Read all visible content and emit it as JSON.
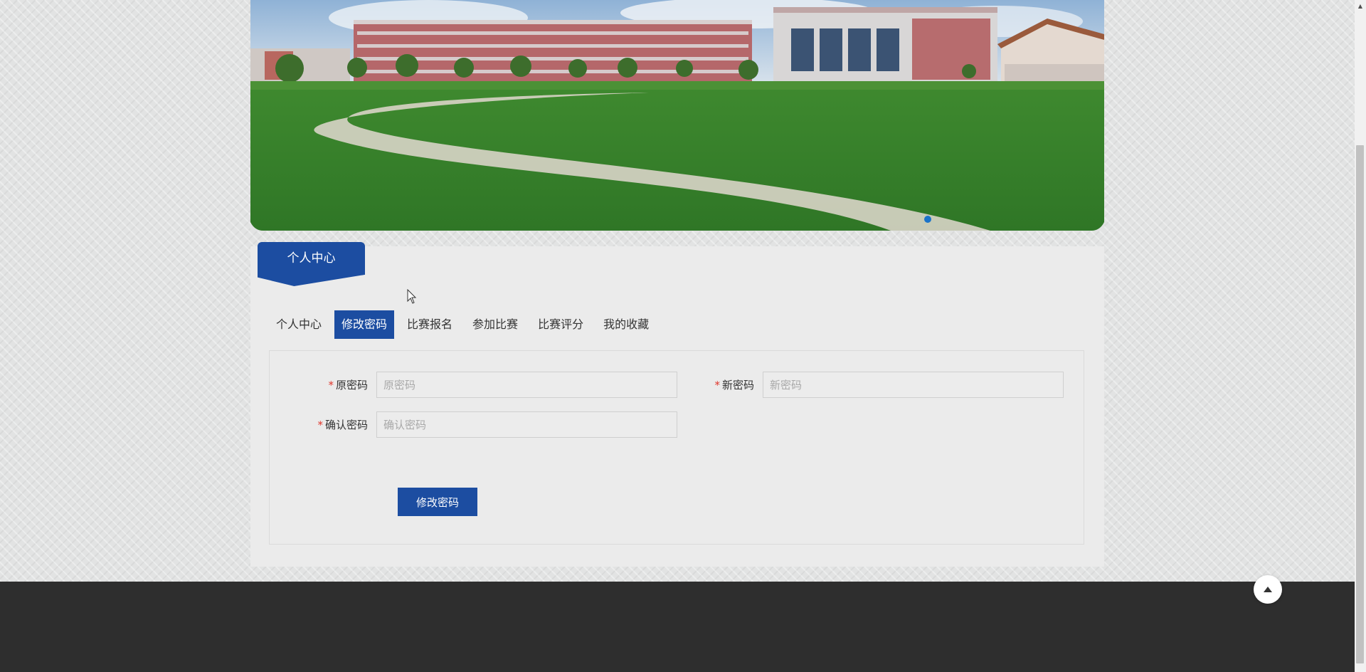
{
  "header": {
    "section_title": "个人中心"
  },
  "tabs": [
    {
      "label": "个人中心",
      "active": false
    },
    {
      "label": "修改密码",
      "active": true
    },
    {
      "label": "比赛报名",
      "active": false
    },
    {
      "label": "参加比赛",
      "active": false
    },
    {
      "label": "比赛评分",
      "active": false
    },
    {
      "label": "我的收藏",
      "active": false
    }
  ],
  "form": {
    "required_mark": "*",
    "old_password": {
      "label": "原密码",
      "placeholder": "原密码"
    },
    "new_password": {
      "label": "新密码",
      "placeholder": "新密码"
    },
    "confirm_password": {
      "label": "确认密码",
      "placeholder": "确认密码"
    },
    "submit_label": "修改密码"
  },
  "colors": {
    "accent": "#1c4da1",
    "required": "#e0352b",
    "footer": "#2e2e2e",
    "carousel_dot": "#1a73c9"
  },
  "icons": {
    "back_to_top": "caret-up-icon",
    "cursor": "mouse-pointer-icon"
  }
}
